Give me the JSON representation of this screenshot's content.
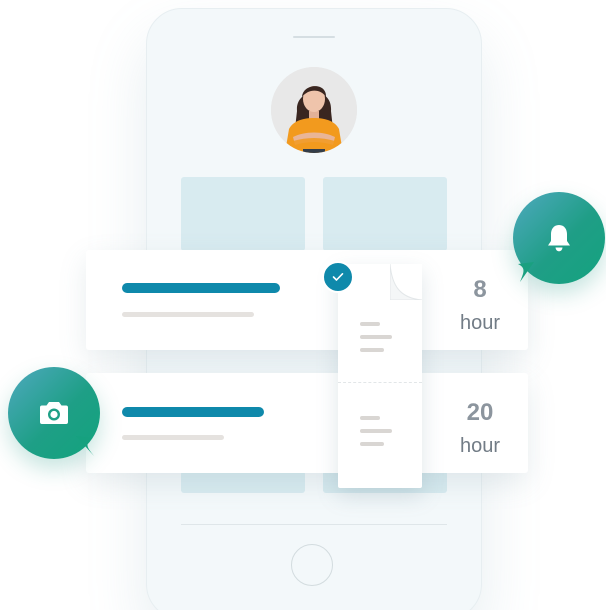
{
  "cards": [
    {
      "value": "8",
      "unit": "hour"
    },
    {
      "value": "20",
      "unit": "hour"
    }
  ],
  "icons": {
    "notification": "bell-icon",
    "camera": "camera-icon",
    "check": "check-icon",
    "document": "document-icon"
  },
  "colors": {
    "accent": "#0f89ab",
    "bubble_green": "#14a37f",
    "phone_background": "#f3f8fa",
    "tile": "#d8ebf0",
    "value_text": "#8c959e"
  }
}
